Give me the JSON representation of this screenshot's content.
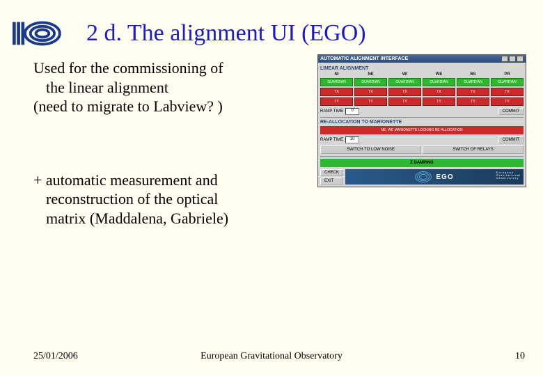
{
  "header": {
    "title": "2 d. The alignment UI (EGO)"
  },
  "content": {
    "bullet1_line1": "Used for the commissioning of",
    "bullet1_line2": "the linear alignment",
    "bullet1_line3": "(need to migrate to Labview? )",
    "bullet2_line1": "+ automatic measurement and",
    "bullet2_line2": "reconstruction of the optical",
    "bullet2_line3": "matrix (Maddalena, Gabriele)"
  },
  "screenshot": {
    "window_title": "AUTOMATIC ALIGNMENT INTERFACE",
    "section1": "LINEAR ALIGNMENT",
    "columns": [
      "NI",
      "NE",
      "WI",
      "WE",
      "BS",
      "PR"
    ],
    "guardian_label": "GUARDIAN",
    "tx_labels": [
      "TX",
      "TX",
      "TX",
      "TX",
      "TX",
      "TX"
    ],
    "ty_labels": [
      "TY",
      "TY",
      "TY",
      "TY",
      "TY",
      "TY"
    ],
    "ramp_label": "RAMP TIME",
    "ramp_value": "0",
    "commit_label": "COMMIT",
    "section2": "RE-ALLOCATION TO MARIONETTE",
    "red_bar_text": "NE, WE MARIONETTE LOCKING RE-ALLOCATION",
    "ramp_label2": "RAMP TIME",
    "ramp_value2": "10",
    "commit_label2": "COMMIT",
    "switch1": "SWITCH TO LOW NOISE",
    "switch2": "SWITCH OF RELAYS",
    "zdamping": "Z DAMPING",
    "check_label": "CHECK",
    "exit_label": "EXIT",
    "ego_brand": "EGO",
    "ego_sub1": "European",
    "ego_sub2": "Gravitational",
    "ego_sub3": "Observatory"
  },
  "footer": {
    "date": "25/01/2006",
    "org": "European Gravitational Observatory",
    "page": "10"
  }
}
